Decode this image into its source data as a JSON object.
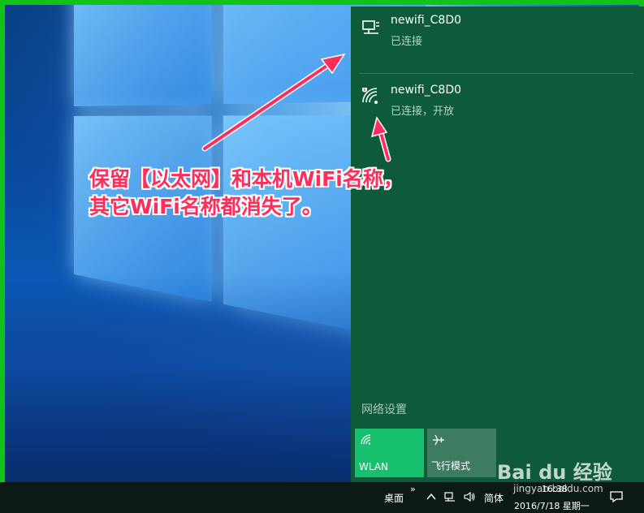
{
  "colors": {
    "frame": "#10c21a",
    "flyout_bg": "#0d5b3b",
    "wlan_tile": "#16c06c",
    "airplane_tile": "#3e7c62",
    "callout": "#ff2d5c"
  },
  "networks": [
    {
      "name": "newifi_C8D0",
      "status": "已连接",
      "icon": "ethernet-icon"
    },
    {
      "name": "newifi_C8D0",
      "status": "已连接，开放",
      "icon": "wifi-secured-icon"
    }
  ],
  "network_settings": "网络设置",
  "quick_actions": [
    {
      "label": "WLAN",
      "icon": "wifi-icon",
      "state": "on"
    },
    {
      "label": "飞行模式",
      "icon": "airplane-icon",
      "state": "off"
    }
  ],
  "taskbar": {
    "desktop_label": "桌面",
    "overflow": "»",
    "ime": "简体",
    "time": "16:38",
    "date": "2016/7/18 星期一"
  },
  "annotation": {
    "line1": "保留【以太网】和本机WiFi名称，",
    "line2": "其它WiFi名称都消失了。"
  },
  "watermark": {
    "main": "Bai du 经验",
    "sub": "jingyan.baidu.com"
  }
}
